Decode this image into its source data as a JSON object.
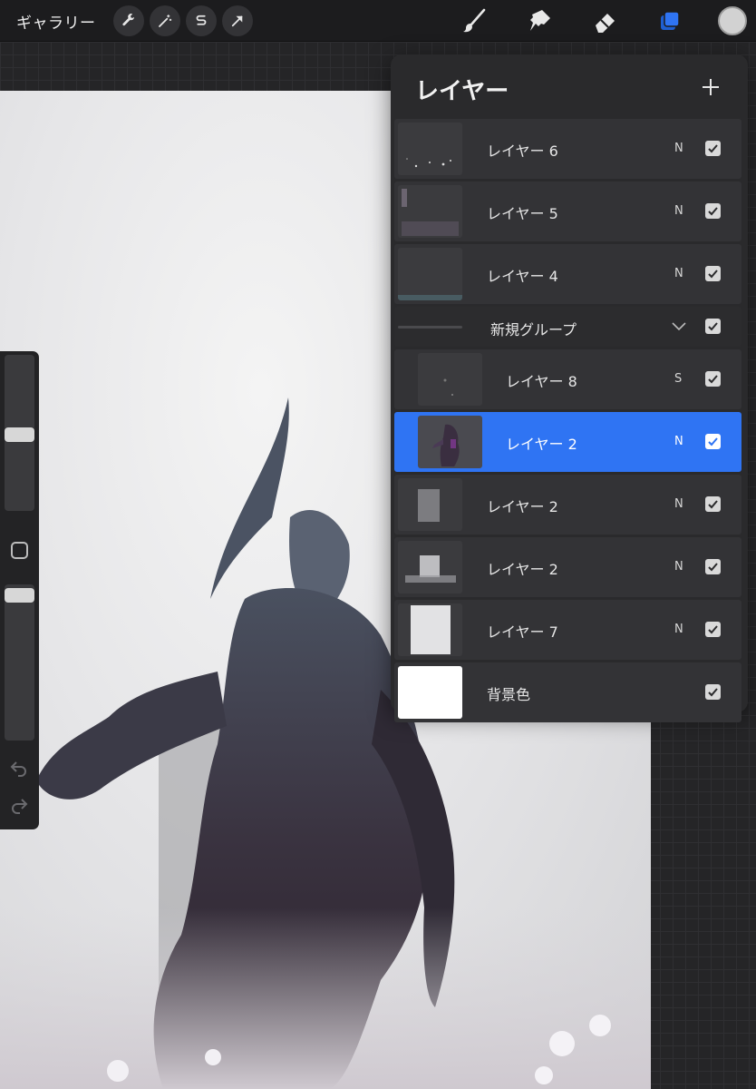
{
  "toolbar": {
    "gallery_label": "ギャラリー",
    "actions": [
      {
        "name": "actions-wrench",
        "icon": "wrench-icon"
      },
      {
        "name": "adjustments-wand",
        "icon": "magic-wand-icon"
      },
      {
        "name": "selection",
        "icon": "selection-s-icon"
      },
      {
        "name": "transform",
        "icon": "transform-arrow-icon"
      }
    ],
    "tools": [
      {
        "name": "brush",
        "icon": "brush-icon"
      },
      {
        "name": "smudge",
        "icon": "smudge-icon"
      },
      {
        "name": "eraser",
        "icon": "eraser-icon"
      },
      {
        "name": "layers",
        "icon": "layers-icon",
        "active": true
      }
    ],
    "accent_color": "#2f74f3",
    "current_color": "#d2d2d2"
  },
  "layers_panel": {
    "title": "レイヤー",
    "add_icon": "plus-icon",
    "layers": [
      {
        "label": "レイヤー 6",
        "blend": "N",
        "visible": true
      },
      {
        "label": "レイヤー 5",
        "blend": "N",
        "visible": true
      },
      {
        "label": "レイヤー 4",
        "blend": "N",
        "visible": true
      },
      {
        "label": "新規グループ",
        "blend": "",
        "visible": true,
        "is_group": true
      },
      {
        "label": "レイヤー 8",
        "blend": "S",
        "visible": true
      },
      {
        "label": "レイヤー 2",
        "blend": "N",
        "visible": true,
        "selected": true
      },
      {
        "label": "レイヤー 2",
        "blend": "N",
        "visible": true
      },
      {
        "label": "レイヤー 2",
        "blend": "N",
        "visible": true
      },
      {
        "label": "レイヤー 7",
        "blend": "N",
        "visible": true
      },
      {
        "label": "背景色",
        "blend": "",
        "visible": true
      }
    ]
  },
  "sidebar": {
    "brush_size_level": 0.5,
    "opacity_level": 1.0
  }
}
